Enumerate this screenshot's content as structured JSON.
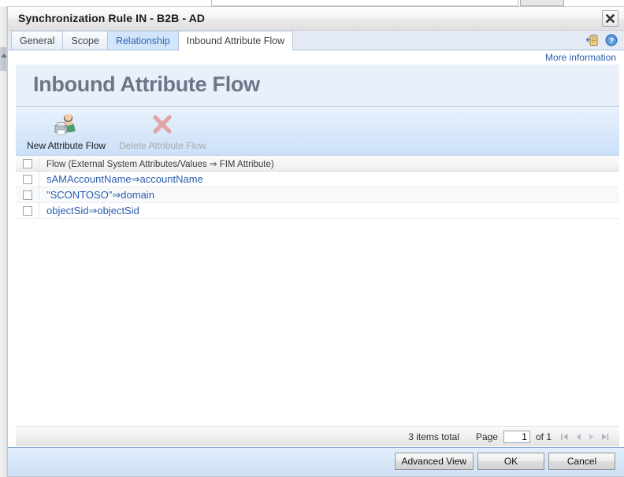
{
  "window": {
    "title": "Synchronization Rule IN - B2B - AD",
    "close_label": "Close",
    "close_icon": "close-x-icon"
  },
  "tabs": [
    {
      "label": "General",
      "state": "normal"
    },
    {
      "label": "Scope",
      "state": "normal"
    },
    {
      "label": "Relationship",
      "state": "hover"
    },
    {
      "label": "Inbound Attribute Flow",
      "state": "active"
    }
  ],
  "tab_icons": [
    {
      "name": "add-clipboard-icon"
    },
    {
      "name": "help-icon"
    }
  ],
  "more_information": "More information",
  "page": {
    "heading": "Inbound Attribute Flow"
  },
  "toolbar": {
    "new_label": "New Attribute Flow",
    "new_icon": "new-user-attribute-icon",
    "delete_label": "Delete Attribute Flow",
    "delete_icon": "red-x-delete-icon"
  },
  "grid": {
    "header": "Flow (External System Attributes/Values ⇒ FIM Attribute)",
    "select_all_checkbox": false,
    "rows": [
      {
        "checked": false,
        "flow": "sAMAccountName⇒accountName"
      },
      {
        "checked": false,
        "flow": "\"SCONTOSO\"⇒domain"
      },
      {
        "checked": false,
        "flow": "objectSid⇒objectSid"
      }
    ]
  },
  "paging": {
    "items_total": "3 items total",
    "page_label": "Page",
    "page_value": "1",
    "of_label": "of 1",
    "first_icon": "first-page-icon",
    "prev_icon": "previous-page-icon",
    "next_icon": "next-page-icon",
    "last_icon": "last-page-icon"
  },
  "footer": {
    "advanced_view": "Advanced View",
    "ok": "OK",
    "cancel": "Cancel"
  },
  "colors": {
    "link": "#2a5db0",
    "heading": "#6b7687",
    "tab_hover_bg": "#d3e5fb",
    "toolbar_bg": "#d5e6fa",
    "footer_border": "#86a9cf"
  }
}
